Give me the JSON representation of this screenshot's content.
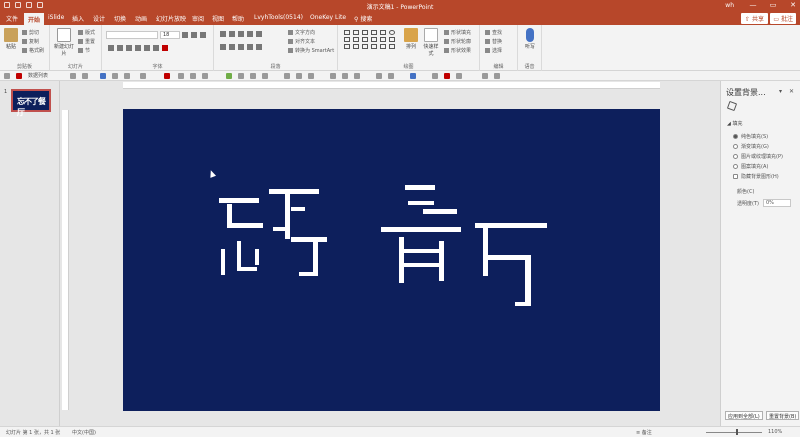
{
  "titlebar": {
    "title": "演示文稿1 - PowerPoint",
    "user": "wh",
    "minimize": "—",
    "restore": "▭",
    "close": "✕"
  },
  "tabs": [
    "文件",
    "开始",
    "iSlide",
    "插入",
    "设计",
    "切换",
    "动画",
    "幻灯片放映",
    "审阅",
    "视图",
    "帮助",
    "LvyhTools(0514)",
    "OneKey Lite"
  ],
  "active_tab": "开始",
  "search_placeholder": "搜索",
  "share_label": "共享",
  "comment_label": "批注",
  "ribbon": {
    "clipboard": {
      "paste": "粘贴",
      "cut": "剪切",
      "copy": "复制",
      "format_painter": "格式刷",
      "label": "剪贴板"
    },
    "slides": {
      "new_slide": "新建幻灯片",
      "layout": "版式",
      "reset": "重置",
      "section": "节",
      "label": "幻灯片"
    },
    "font": {
      "label": "字体",
      "size": "18"
    },
    "paragraph": {
      "label": "段落",
      "text_direction": "文字方向",
      "align_text": "对齐文本",
      "smartart": "转换为 SmartArt"
    },
    "drawing": {
      "arrange": "排列",
      "quick_styles": "快速样式",
      "fill": "形状填充",
      "outline": "形状轮廓",
      "effects": "形状效果",
      "label": "绘图"
    },
    "editing": {
      "find": "查找",
      "replace": "替换",
      "select": "选择",
      "label": "编辑"
    },
    "voice": {
      "dictate": "听写",
      "label": "语音"
    }
  },
  "qat_zoom": "数据列表",
  "thumbnail": {
    "number": "1",
    "text": "忘不了餐厅"
  },
  "format_pane": {
    "title": "设置背景...",
    "section": "填充",
    "options": [
      {
        "label": "纯色填充(S)",
        "selected": true
      },
      {
        "label": "渐变填充(G)",
        "selected": false
      },
      {
        "label": "图片或纹理填充(P)",
        "selected": false
      },
      {
        "label": "图案填充(A)",
        "selected": false
      },
      {
        "label": "隐藏背景图形(H)",
        "selected": false
      }
    ],
    "color_label": "颜色(C)",
    "transparency_label": "透明度(T)",
    "transparency_value": "0%",
    "apply_all": "应用到全部(L)",
    "reset_bg": "重置背景(B)"
  },
  "status": {
    "slide_info": "幻灯片 第 1 张，共 1 张",
    "language": "中文(中国)",
    "notes": "备注",
    "zoom": "110%"
  },
  "colors": {
    "brand": "#b7472a",
    "slide_bg": "#0d1f5c",
    "title_text": "#ffffff"
  }
}
